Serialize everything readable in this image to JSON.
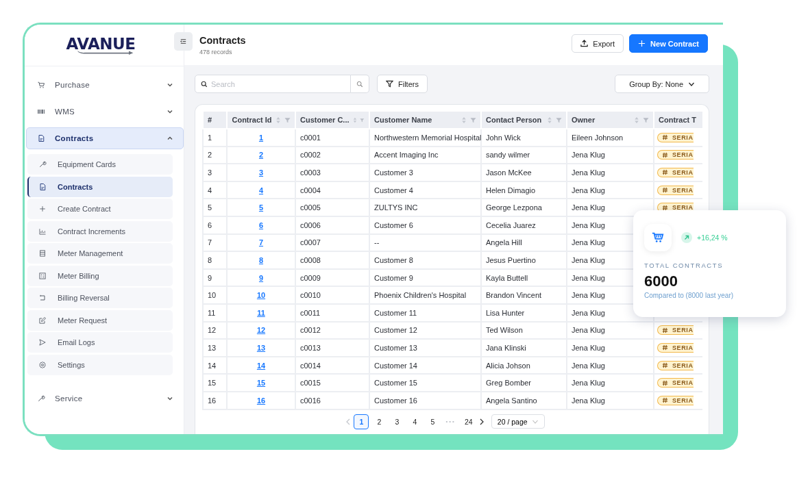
{
  "logo": {
    "text": "AVANUE"
  },
  "sidebar": {
    "items": [
      {
        "label": "Purchase",
        "selected": false,
        "expanded": false
      },
      {
        "label": "WMS",
        "selected": false,
        "expanded": false
      },
      {
        "label": "Contracts",
        "selected": true,
        "expanded": true,
        "children": [
          {
            "label": "Equipment Cards",
            "selected": false
          },
          {
            "label": "Contracts",
            "selected": true
          },
          {
            "label": "Create Contract",
            "selected": false
          },
          {
            "label": "Contract Increments",
            "selected": false
          },
          {
            "label": "Meter Management",
            "selected": false
          },
          {
            "label": "Meter Billing",
            "selected": false
          },
          {
            "label": "Billing Reversal",
            "selected": false
          },
          {
            "label": "Meter Request",
            "selected": false
          },
          {
            "label": "Email Logs",
            "selected": false
          },
          {
            "label": "Settings",
            "selected": false
          }
        ]
      },
      {
        "label": "Service",
        "selected": false,
        "expanded": false
      }
    ]
  },
  "header": {
    "title": "Contracts",
    "subtitle": "478 records",
    "buttons": [
      {
        "kind": "export",
        "label": "Export"
      },
      {
        "kind": "primary",
        "label": "New Contract"
      }
    ]
  },
  "toolbar": {
    "search": {
      "placeholder": "Search"
    },
    "filters": "Filters",
    "group_by": "Group By: None"
  },
  "table": {
    "columns": [
      {
        "label": "#",
        "sortable": false,
        "filterable": false
      },
      {
        "label": "Contract Id",
        "sortable": true,
        "filterable": true
      },
      {
        "label": "Customer C...",
        "sortable": true,
        "filterable": true
      },
      {
        "label": "Customer Name",
        "sortable": true,
        "filterable": true
      },
      {
        "label": "Contact Person",
        "sortable": true,
        "filterable": true
      },
      {
        "label": "Owner",
        "sortable": true,
        "filterable": true
      },
      {
        "label": "Contract T"
      }
    ],
    "rows": [
      {
        "n": "1",
        "contract_id": "1",
        "customer_code": "c0001",
        "customer_name": "Northwestern Memorial Hospital",
        "contact_person": "John Wick",
        "owner": "Eileen Johnson",
        "contract_type": "SERIA"
      },
      {
        "n": "2",
        "contract_id": "2",
        "customer_code": "c0002",
        "customer_name": "Accent Imaging Inc",
        "contact_person": "sandy wilmer",
        "owner": "Jena Klug",
        "contract_type": "SERIA"
      },
      {
        "n": "3",
        "contract_id": "3",
        "customer_code": "c0003",
        "customer_name": "Customer 3",
        "contact_person": "Jason McKee",
        "owner": "Jena Klug",
        "contract_type": "SERIA"
      },
      {
        "n": "4",
        "contract_id": "4",
        "customer_code": "c0004",
        "customer_name": "Customer 4",
        "contact_person": "Helen Dimagio",
        "owner": "Jena Klug",
        "contract_type": "SERIA"
      },
      {
        "n": "5",
        "contract_id": "5",
        "customer_code": "c0005",
        "customer_name": "ZULTYS INC",
        "contact_person": "George Lezpona",
        "owner": "Jena Klug",
        "contract_type": "SERIA"
      },
      {
        "n": "6",
        "contract_id": "6",
        "customer_code": "c0006",
        "customer_name": "Customer 6",
        "contact_person": "Cecelia Juarez",
        "owner": "Jena Klug"
      },
      {
        "n": "7",
        "contract_id": "7",
        "customer_code": "c0007",
        "customer_name": "--",
        "contact_person": "Angela Hill",
        "owner": "Jena Klug"
      },
      {
        "n": "8",
        "contract_id": "8",
        "customer_code": "c0008",
        "customer_name": "Customer 8",
        "contact_person": "Jesus Puertino",
        "owner": "Jena Klug"
      },
      {
        "n": "9",
        "contract_id": "9",
        "customer_code": "c0009",
        "customer_name": "Customer 9",
        "contact_person": "Kayla Buttell",
        "owner": "Jena Klug"
      },
      {
        "n": "10",
        "contract_id": "10",
        "customer_code": "c0010",
        "customer_name": "Phoenix Children's Hospital",
        "contact_person": "Brandon Vincent",
        "owner": "Jena Klug"
      },
      {
        "n": "11",
        "contract_id": "11",
        "customer_code": "c0011",
        "customer_name": "Customer 11",
        "contact_person": "Lisa Hunter",
        "owner": "Jena Klug"
      },
      {
        "n": "12",
        "contract_id": "12",
        "customer_code": "c0012",
        "customer_name": "Customer 12",
        "contact_person": "Ted Wilson",
        "owner": "Jena Klug",
        "contract_type": "SERIA"
      },
      {
        "n": "13",
        "contract_id": "13",
        "customer_code": "c0013",
        "customer_name": "Customer 13",
        "contact_person": "Jana Klinski",
        "owner": "Jena Klug",
        "contract_type": "SERIA"
      },
      {
        "n": "14",
        "contract_id": "14",
        "customer_code": "c0014",
        "customer_name": "Customer 14",
        "contact_person": "Alicia Johson",
        "owner": "Jena Klug",
        "contract_type": "SERIA"
      },
      {
        "n": "15",
        "contract_id": "15",
        "customer_code": "c0015",
        "customer_name": "Customer 15",
        "contact_person": "Greg Bomber",
        "owner": "Jena Klug",
        "contract_type": "SERIA"
      },
      {
        "n": "16",
        "contract_id": "16",
        "customer_code": "c0016",
        "customer_name": "Customer 16",
        "contact_person": "Angela Santino",
        "owner": "Jena Klug",
        "contract_type": "SERIA"
      }
    ]
  },
  "pagination": {
    "pages": [
      {
        "kind": "page",
        "label": "1",
        "selected": true
      },
      {
        "kind": "page",
        "label": "2",
        "selected": false
      },
      {
        "kind": "page",
        "label": "3",
        "selected": false
      },
      {
        "kind": "page",
        "label": "4",
        "selected": false
      },
      {
        "kind": "page",
        "label": "5",
        "selected": false
      },
      {
        "kind": "ellipsis",
        "label": "•••"
      },
      {
        "kind": "page",
        "label": "24",
        "selected": false
      }
    ],
    "page_size": "20 / page"
  },
  "stat_card": {
    "trend": "+16,24 %",
    "label": "TOTAL CONTRACTS",
    "value": "6000",
    "comparison": "Compared to (8000 last year)"
  }
}
